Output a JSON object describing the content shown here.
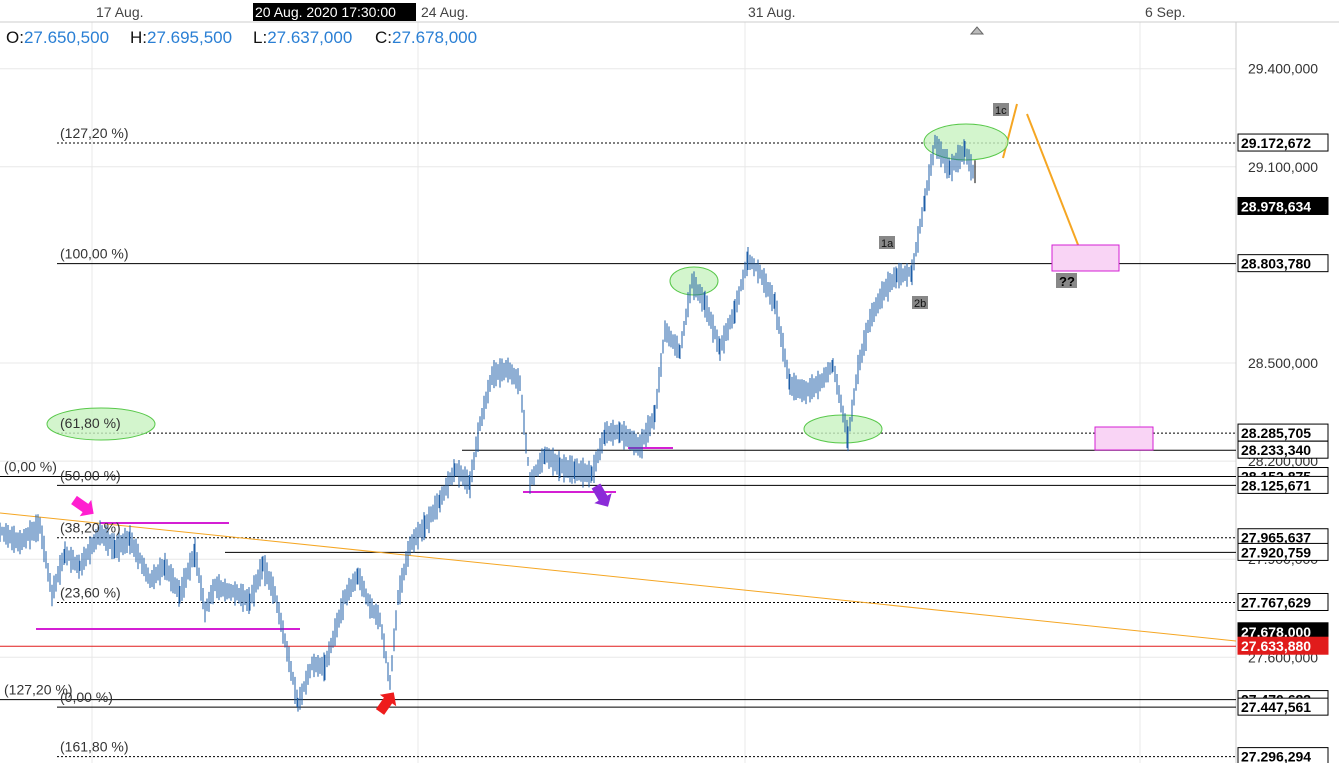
{
  "header": {
    "open_key": "O:",
    "open_val": "27.650,500",
    "high_key": "H:",
    "high_val": "27.695,500",
    "low_key": "L:",
    "low_val": "27.637,000",
    "close_key": "C:",
    "close_val": "27.678,000"
  },
  "colors": {
    "candle": "#1f5fa8",
    "fib_line": "#000000",
    "red_line": "#e11b1b",
    "orange": "#f5a623",
    "magenta": "#d41fd4",
    "green_fill": "#c8f2c0",
    "green_stroke": "#58c84a",
    "zone_fill": "#f9d4f5",
    "grid": "#e8e8e8",
    "price_axis_bg": "#ffffff",
    "last_bg": "#000000",
    "red_bg": "#e11b1b"
  },
  "chart_data": {
    "type": "candlestick",
    "x_dates": [
      "17 Aug.",
      "24 Aug.",
      "31 Aug.",
      "6 Sep."
    ],
    "crosshair_date": "20 Aug. 2020 17:30:00",
    "y_ticks": [
      "29.400,000",
      "29.100,000",
      "28.500,000",
      "28.200,000",
      "27.900,000",
      "27.600,000"
    ],
    "ylim": [
      27.27,
      29.55
    ],
    "price_labels": [
      {
        "text": "29.172,672",
        "value": 29.172672,
        "style": "box"
      },
      {
        "text": "28.978,634",
        "value": 28.978634,
        "style": "dark"
      },
      {
        "text": "28.803,780",
        "value": 28.80378,
        "style": "box"
      },
      {
        "text": "28.285,705",
        "value": 28.285705,
        "style": "box"
      },
      {
        "text": "28.233,340",
        "value": 28.23334,
        "style": "box"
      },
      {
        "text": "28.152,875",
        "value": 28.152875,
        "style": "box"
      },
      {
        "text": "28.125,671",
        "value": 28.125671,
        "style": "box"
      },
      {
        "text": "27.965,637",
        "value": 27.965637,
        "style": "box"
      },
      {
        "text": "27.920,759",
        "value": 27.920759,
        "style": "box"
      },
      {
        "text": "27.767,629",
        "value": 27.767629,
        "style": "box"
      },
      {
        "text": "27.678,000",
        "value": 27.678,
        "style": "dark"
      },
      {
        "text": "27.633,880",
        "value": 27.63388,
        "style": "red"
      },
      {
        "text": "27.470,683",
        "value": 27.470683,
        "style": "box"
      },
      {
        "text": "27.447,561",
        "value": 27.447561,
        "style": "box"
      },
      {
        "text": "27.296,294",
        "value": 27.296294,
        "style": "box"
      }
    ],
    "fib_levels": [
      {
        "label": "(127,20 %)",
        "value": 29.172672,
        "dashed": true
      },
      {
        "label": "(100,00 %)",
        "value": 28.80378,
        "dashed": false
      },
      {
        "label": "(61,80 %)",
        "value": 28.285705,
        "dashed": true
      },
      {
        "label": "(0,00 %)",
        "value": 28.152875,
        "dashed": false
      },
      {
        "label": "(50,00 %)",
        "value": 28.125671,
        "dashed": false
      },
      {
        "label": "(38,20 %)",
        "value": 27.965637,
        "dashed": true
      },
      {
        "label": "(23,60 %)",
        "value": 27.767629,
        "dashed": true
      },
      {
        "label": "(127,20 %)",
        "value": 27.470683,
        "dashed": false
      },
      {
        "label": "(0,00 %)",
        "value": 27.447561,
        "dashed": false
      },
      {
        "label": "(161,80 %)",
        "value": 27.296294,
        "dashed": true
      }
    ],
    "wave_labels": [
      "1c",
      "1a",
      "2b",
      "??"
    ]
  }
}
